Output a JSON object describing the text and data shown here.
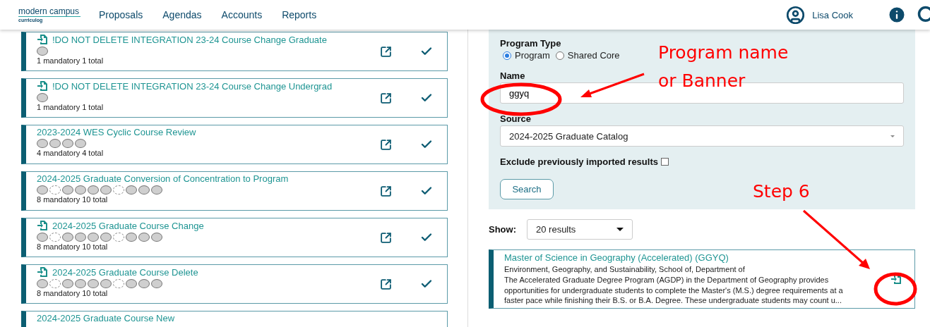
{
  "header": {
    "logo": {
      "name": "modern campus",
      "product": "curriculog"
    },
    "nav": [
      {
        "label": "Proposals"
      },
      {
        "label": "Agendas"
      },
      {
        "label": "Accounts"
      },
      {
        "label": "Reports"
      }
    ],
    "user": {
      "name": "Lisa Cook"
    }
  },
  "processes": [
    {
      "title": "!DO NOT DELETE INTEGRATION 23-24 Course Change Graduate",
      "imported": true,
      "steps": [
        {
          "mandatory": true
        }
      ],
      "summary": "1 mandatory 1 total"
    },
    {
      "title": "!DO NOT DELETE INTEGRATION 23-24 Course Change Undergrad",
      "imported": true,
      "steps": [
        {
          "mandatory": true
        }
      ],
      "summary": "1 mandatory 1 total"
    },
    {
      "title": "2023-2024 WES Cyclic Course Review",
      "imported": false,
      "steps": [
        {
          "mandatory": true
        },
        {
          "mandatory": true
        },
        {
          "mandatory": true
        },
        {
          "mandatory": true
        }
      ],
      "summary": "4 mandatory 4 total"
    },
    {
      "title": "2024-2025 Graduate Conversion of Concentration to Program",
      "imported": false,
      "steps": [
        {
          "mandatory": true
        },
        {
          "mandatory": false
        },
        {
          "mandatory": true
        },
        {
          "mandatory": true
        },
        {
          "mandatory": true
        },
        {
          "mandatory": true
        },
        {
          "mandatory": false
        },
        {
          "mandatory": true
        },
        {
          "mandatory": true
        },
        {
          "mandatory": true
        }
      ],
      "summary": "8 mandatory 10 total"
    },
    {
      "title": "2024-2025 Graduate Course Change",
      "imported": true,
      "steps": [
        {
          "mandatory": true
        },
        {
          "mandatory": false
        },
        {
          "mandatory": true
        },
        {
          "mandatory": true
        },
        {
          "mandatory": true
        },
        {
          "mandatory": true
        },
        {
          "mandatory": false
        },
        {
          "mandatory": true
        },
        {
          "mandatory": true
        },
        {
          "mandatory": true
        }
      ],
      "summary": "8 mandatory 10 total"
    },
    {
      "title": "2024-2025 Graduate Course Delete",
      "imported": true,
      "steps": [
        {
          "mandatory": true
        },
        {
          "mandatory": false
        },
        {
          "mandatory": true
        },
        {
          "mandatory": true
        },
        {
          "mandatory": true
        },
        {
          "mandatory": true
        },
        {
          "mandatory": false
        },
        {
          "mandatory": true
        },
        {
          "mandatory": true
        },
        {
          "mandatory": true
        }
      ],
      "summary": "8 mandatory 10 total"
    },
    {
      "title": "2024-2025 Graduate Course New",
      "imported": false
    }
  ],
  "search_form": {
    "program_type": {
      "label": "Program Type",
      "options": [
        {
          "label": "Program",
          "selected": true
        },
        {
          "label": "Shared Core",
          "selected": false
        }
      ]
    },
    "name": {
      "label": "Name",
      "value": "ggyq"
    },
    "source": {
      "label": "Source",
      "value": "2024-2025 Graduate Catalog"
    },
    "exclude": {
      "label": "Exclude previously imported results",
      "checked": false
    },
    "search_button": "Search"
  },
  "show": {
    "label": "Show:",
    "value": "20 results"
  },
  "results": [
    {
      "title": "Master of Science in Geography (Accelerated) (GGYQ)",
      "department": "Environment, Geography, and Sustainability, School of, Department of",
      "description": "The Accelerated Graduate Degree Program (AGDP) in the Department of Geography provides opportunities for undergraduate students to complete the Master's (M.S.) degree requirements at a faster pace while finishing their B.S. or B.A. Degree. These undergraduate students may count u..."
    }
  ],
  "annotations": [
    {
      "kind": "callout",
      "lines": [
        "Program name",
        "or Banner"
      ]
    },
    {
      "kind": "step",
      "lines": [
        "Step 6"
      ]
    }
  ]
}
